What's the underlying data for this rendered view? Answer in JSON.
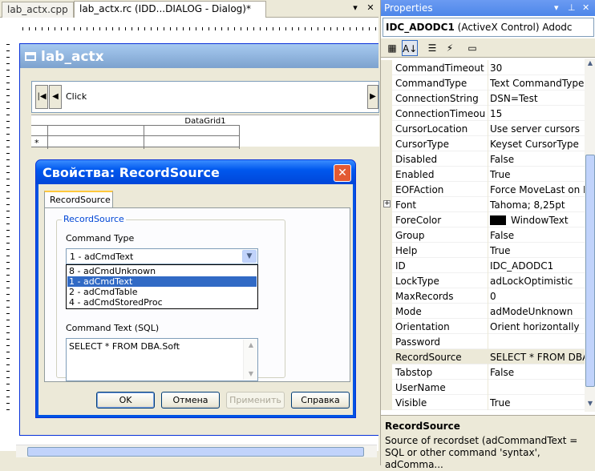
{
  "editor": {
    "tabs": [
      {
        "label": "lab_actx.cpp"
      },
      {
        "label": "lab_actx.rc (IDD...DIALOG - Dialog)*"
      }
    ],
    "tab_dropdown": "▾",
    "tab_close": "✕",
    "designed_dialog_title": "lab_actx",
    "adodc_caption": "Click",
    "datagrid_caption": "DataGrid1",
    "grid_new_row_marker": "*"
  },
  "modal": {
    "title": "Свойства: RecordSource",
    "close": "✕",
    "tab": "RecordSource",
    "group_legend": "RecordSource",
    "command_type_label": "Command Type",
    "command_type_value": "1 - adCmdText",
    "command_type_options": [
      {
        "label": "8 - adCmdUnknown",
        "selected": false
      },
      {
        "label": "1 - adCmdText",
        "selected": true
      },
      {
        "label": "2 - adCmdTable",
        "selected": false
      },
      {
        "label": "4 - adCmdStoredProc",
        "selected": false
      }
    ],
    "command_text_label": "Command Text (SQL)",
    "command_text_value": "SELECT * FROM DBA.Soft",
    "buttons": {
      "ok": "OK",
      "cancel": "Отмена",
      "apply": "Применить",
      "help": "Справка"
    }
  },
  "properties": {
    "title": "Properties",
    "object_name": "IDC_ADODC1",
    "object_type": "(ActiveX Control)  Adodc",
    "rows": [
      {
        "name": "CommandTimeout",
        "value": "30"
      },
      {
        "name": "CommandType",
        "value": "Text CommandType"
      },
      {
        "name": "ConnectionString",
        "value": "DSN=Test"
      },
      {
        "name": "ConnectionTimeout",
        "value": "15"
      },
      {
        "name": "CursorLocation",
        "value": "Use server cursors"
      },
      {
        "name": "CursorType",
        "value": "Keyset CursorType"
      },
      {
        "name": "Disabled",
        "value": "False"
      },
      {
        "name": "Enabled",
        "value": "True"
      },
      {
        "name": "EOFAction",
        "value": "Force MoveLast on EOF"
      },
      {
        "name": "Font",
        "value": "Tahoma; 8,25pt"
      },
      {
        "name": "ForeColor",
        "value": "WindowText"
      },
      {
        "name": "Group",
        "value": "False"
      },
      {
        "name": "Help",
        "value": "True"
      },
      {
        "name": "ID",
        "value": "IDC_ADODC1"
      },
      {
        "name": "LockType",
        "value": "adLockOptimistic"
      },
      {
        "name": "MaxRecords",
        "value": "0"
      },
      {
        "name": "Mode",
        "value": "adModeUnknown"
      },
      {
        "name": "Orientation",
        "value": "Orient horizontally"
      },
      {
        "name": "Password",
        "value": ""
      },
      {
        "name": "RecordSource",
        "value": "SELECT * FROM DBA.Soft"
      },
      {
        "name": "Tabstop",
        "value": "False"
      },
      {
        "name": "UserName",
        "value": ""
      },
      {
        "name": "Visible",
        "value": "True"
      }
    ],
    "description_title": "RecordSource",
    "description_text": "Source of recordset (adCommandText = SQL or other command 'syntax', adComma..."
  }
}
